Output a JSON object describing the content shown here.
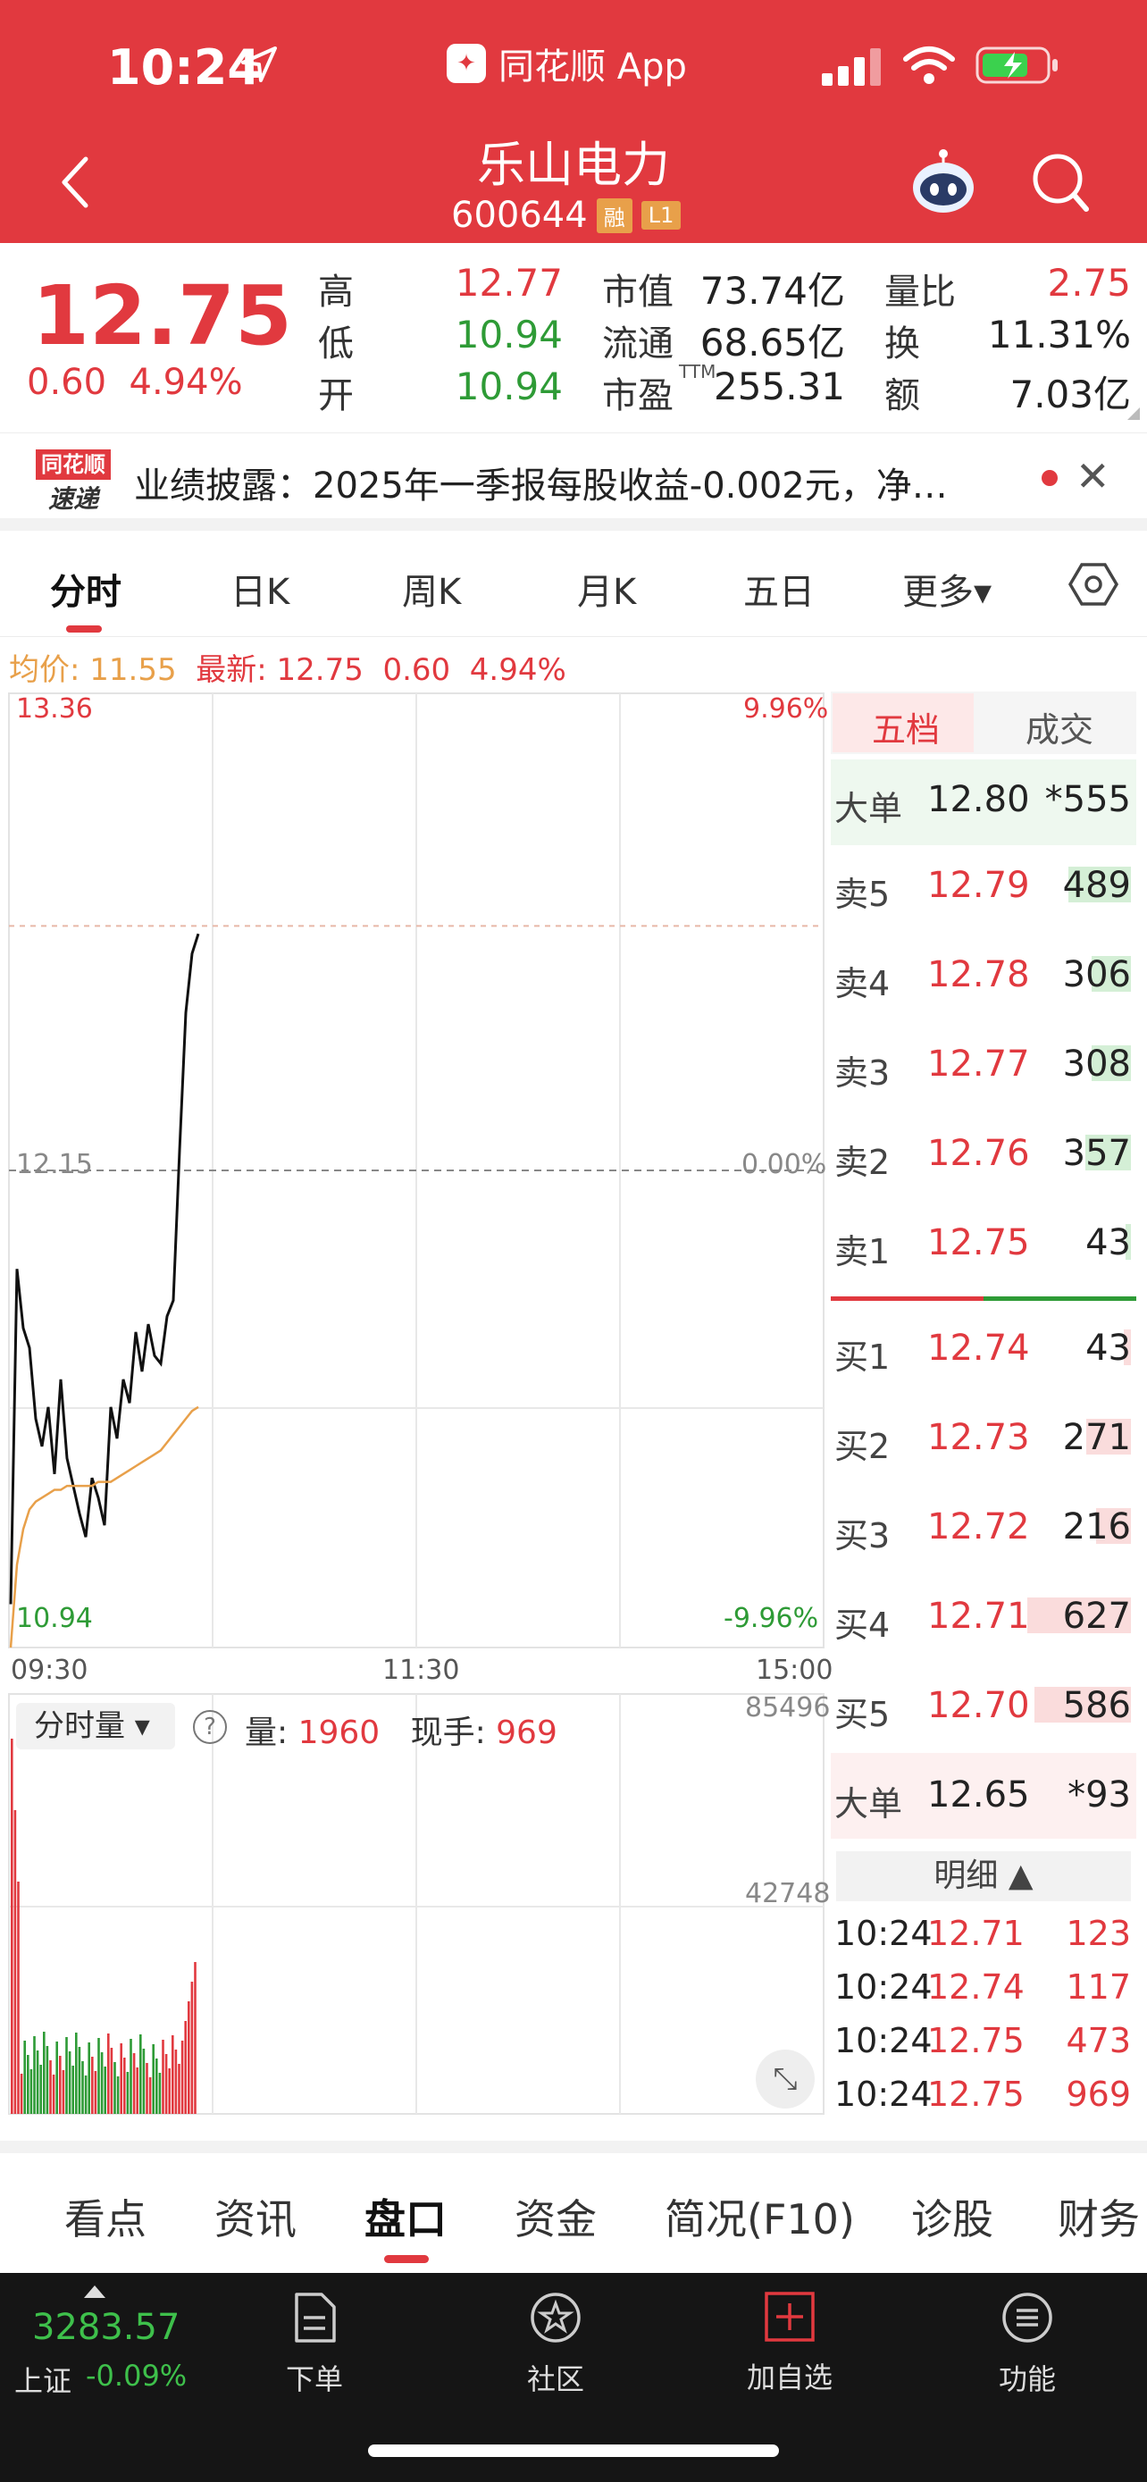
{
  "status_bar": {
    "time": "10:24",
    "app_label": "同花顺 App"
  },
  "header": {
    "stock_name": "乐山电力",
    "stock_code": "600644",
    "tags": [
      "融",
      "L1"
    ]
  },
  "quote": {
    "price": "12.75",
    "change": "0.60",
    "change_pct": "4.94%",
    "stats": [
      {
        "label": "高",
        "value": "12.77",
        "color": "#e1393f"
      },
      {
        "label": "低",
        "value": "10.94",
        "color": "#2e9b36"
      },
      {
        "label": "开",
        "value": "10.94",
        "color": "#2e9b36"
      },
      {
        "label": "市值",
        "value": "73.74亿",
        "color": "#222222"
      },
      {
        "label": "流通",
        "value": "68.65亿",
        "color": "#222222"
      },
      {
        "label": "市盈",
        "sup": "TTM",
        "value": "255.31",
        "color": "#222222"
      },
      {
        "label": "量比",
        "value": "2.75",
        "color": "#e1393f"
      },
      {
        "label": "换",
        "value": "11.31%",
        "color": "#222222"
      },
      {
        "label": "额",
        "value": "7.03亿",
        "color": "#222222"
      }
    ]
  },
  "news": {
    "logo_top": "同花顺",
    "logo_bottom": "速递",
    "text": "业绩披露：2025年一季报每股收益-0.002元，净…"
  },
  "period_tabs": [
    "分时",
    "日K",
    "周K",
    "月K",
    "五日",
    "更多▾"
  ],
  "avg_line": {
    "avg_label": "均价: 11.55",
    "latest_label": "最新: 12.75",
    "change": "0.60",
    "pct": "4.94%"
  },
  "chart": {
    "top_price": "13.36",
    "mid_price": "12.15",
    "bottom_price": "10.94",
    "top_pct": "9.96%",
    "mid_pct": "0.00%",
    "bottom_pct": "-9.96%",
    "times": [
      "09:30",
      "11:30",
      "15:00"
    ],
    "volume_max": "85496",
    "volume_mid": "42748",
    "volume_selector": "分时量",
    "volume_info_label": "量:",
    "volume_info_value": "1960",
    "hand_label": "现手:",
    "hand_value": "969"
  },
  "chart_data": {
    "type": "line",
    "series": [
      {
        "values": [
          11.05,
          11.9,
          11.75,
          11.7,
          11.52,
          11.45,
          11.55,
          11.38,
          11.62,
          11.42,
          11.35,
          11.28,
          11.22,
          11.37,
          11.32,
          11.25,
          11.55,
          11.47,
          11.62,
          11.56,
          11.74,
          11.64,
          11.76,
          11.68,
          11.66,
          11.78,
          11.82,
          12.2,
          12.55,
          12.7,
          12.75
        ]
      },
      {
        "values": [
          10.94,
          11.15,
          11.24,
          11.29,
          11.31,
          11.32,
          11.33,
          11.34,
          11.34,
          11.35,
          11.35,
          11.35,
          11.35,
          11.35,
          11.36,
          11.36,
          11.36,
          11.37,
          11.38,
          11.39,
          11.4,
          11.41,
          11.42,
          11.43,
          11.44,
          11.46,
          11.48,
          11.5,
          11.52,
          11.54,
          11.55
        ]
      }
    ],
    "ylim": [
      10.94,
      13.36
    ]
  },
  "order_book": {
    "tabs": [
      "五档",
      "成交"
    ],
    "big_sell": {
      "label": "大单",
      "price": "12.80",
      "vol": "*555"
    },
    "asks": [
      {
        "label": "卖5",
        "price": "12.79",
        "vol": "489",
        "bar": 0.78
      },
      {
        "label": "卖4",
        "price": "12.78",
        "vol": "306",
        "bar": 0.49
      },
      {
        "label": "卖3",
        "price": "12.77",
        "vol": "308",
        "bar": 0.49
      },
      {
        "label": "卖2",
        "price": "12.76",
        "vol": "357",
        "bar": 0.57
      },
      {
        "label": "卖1",
        "price": "12.75",
        "vol": "43",
        "bar": 0.07
      }
    ],
    "bids": [
      {
        "label": "买1",
        "price": "12.74",
        "vol": "43",
        "bar": 0.07
      },
      {
        "label": "买2",
        "price": "12.73",
        "vol": "271",
        "bar": 0.43
      },
      {
        "label": "买3",
        "price": "12.72",
        "vol": "216",
        "bar": 0.34
      },
      {
        "label": "买4",
        "price": "12.71",
        "vol": "627",
        "bar": 1.0
      },
      {
        "label": "买5",
        "price": "12.70",
        "vol": "586",
        "bar": 0.93
      }
    ],
    "big_buy": {
      "label": "大单",
      "price": "12.65",
      "vol": "*93"
    },
    "detail_label": "明细 ▲",
    "details": [
      {
        "time": "10:24",
        "price": "12.71",
        "vol": "123"
      },
      {
        "time": "10:24",
        "price": "12.74",
        "vol": "117"
      },
      {
        "time": "10:24",
        "price": "12.75",
        "vol": "473"
      },
      {
        "time": "10:24",
        "price": "12.75",
        "vol": "969"
      }
    ]
  },
  "bottom_tabs": [
    "看点",
    "资讯",
    "盘口",
    "资金",
    "简况(F10)",
    "诊股",
    "财务"
  ],
  "nav": {
    "index_value": "3283.57",
    "index_name": "上证",
    "index_change": "-0.09%",
    "items": [
      "下单",
      "社区",
      "加自选",
      "功能"
    ]
  },
  "colors": {
    "up": "#e1393f",
    "down": "#2e9b36",
    "header": "#e1393f",
    "avg": "#e8a04a"
  }
}
